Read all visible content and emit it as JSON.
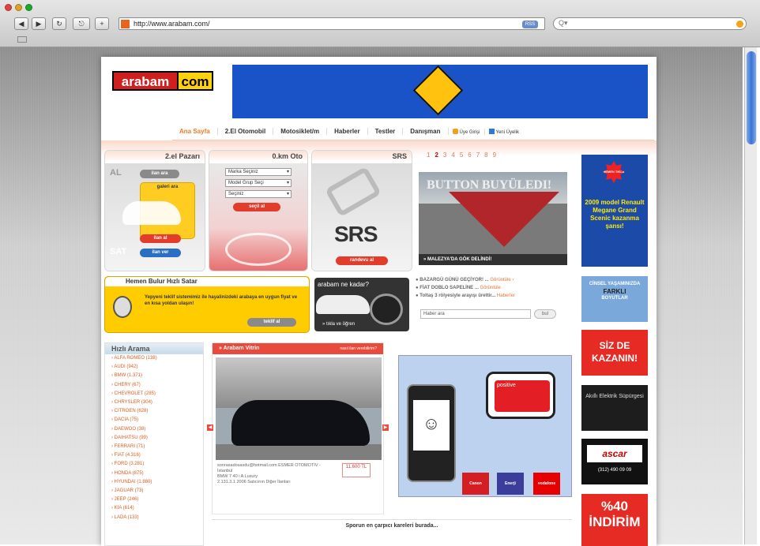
{
  "browser": {
    "url": "http://www.arabam.com/",
    "rss_label": "RSS",
    "search_placeholder": "Q▾"
  },
  "site": {
    "logo_part1": "arabam",
    "logo_part2": "com"
  },
  "nav": {
    "items": [
      "Ana Sayfa",
      "2.El Otomobil",
      "Motosiklet/m",
      "Haberler",
      "Testler",
      "Danışman"
    ],
    "login": "Üye Girişi",
    "register": "Yeni Üyelik"
  },
  "panels": {
    "ikinciel": {
      "title": "2.el Pazarı",
      "al": "AL",
      "sat": "SAT",
      "ilan_ara": "ilan ara",
      "galeri_ara": "galeri ara",
      "ilan_ver": "ilan ver",
      "ilan_al": "ilan al"
    },
    "sifir": {
      "title": "0.km Oto",
      "marka": "Marka Seçiniz",
      "model": "Model Grup Seçi",
      "secim": "Seçiniz",
      "button": "seçil al"
    },
    "srs": {
      "title": "SRS",
      "logo": "SRS",
      "button": "randevu al"
    }
  },
  "slider": {
    "pages": [
      "1",
      "2",
      "3",
      "4",
      "5",
      "6",
      "7",
      "8",
      "9"
    ],
    "current": "2",
    "title": "BUTTON BUYÜLEDI!",
    "caption": "» MALEZYA'DA GÖK DELİNDİ!"
  },
  "hemen": {
    "title": "Hemen Bulur Hızlı Satar",
    "text": "Yepyeni teklif sistemimiz ile hayalinizdeki arabaya en uygun fiyat ve en kısa yoldan ulaşın!",
    "button": "teklif al"
  },
  "arabam_ne_kadar": {
    "title": "arabam ne kadar?",
    "footer": "» tıkla ve öğren"
  },
  "news": {
    "items": [
      "BAZARGÜ GÜNÜ GEÇİYOR! ...",
      "FİAT DOBLO SAPELİNE ...",
      "Toltaş 3 rölyesiyle arayışı ürettir..."
    ],
    "links": [
      "Görüntüle ›",
      "Görüntüle",
      "Haberler"
    ],
    "search_placeholder": "Haber ara",
    "search_button": "bul"
  },
  "hizli": {
    "title": "Hızlı Arama",
    "brands": [
      "› ALFA ROMEO (138)",
      "› AUDI (942)",
      "› BMW (1.371)",
      "› CHERY (67)",
      "› CHEVROLET (285)",
      "› CHRYSLER (304)",
      "› CITROEN (628)",
      "› DACIA (75)",
      "› DAEWOO (38)",
      "› DAIHATSU (99)",
      "› FERRARI (71)",
      "› FIAT (4.316)",
      "› FORD (3.281)",
      "› HONDA (875)",
      "› HYUNDAI (1.880)",
      "› JAGUAR (73)",
      "› JEEP (246)",
      "› KIA (614)",
      "› LADA (133)"
    ]
  },
  "vitrin": {
    "title": "» Arabam Vitrin",
    "more": "nasıl ilan verebilirim?",
    "seller": "sonrasadosasdu@hotmail.com ESMER OTOMOTİV - İstanbul",
    "model": "BMW 7 40 i A Luxury",
    "info": "2.131.3.1 2006  Satıcının Diğer İlanları",
    "price": "11.600 TL"
  },
  "phone_ad": {
    "brand": "positive",
    "logos": [
      "Canon",
      "Enerji",
      "vodafone"
    ]
  },
  "side_ads": {
    "ad1_star": "HEMEN TIKLA",
    "ad1_text": "2009 model Renault Megane Grand Scenic kazanma şansı!",
    "ad2_line1": "CİNSEL YAŞAMINIZDA",
    "ad2_line2": "FARKLI",
    "ad2_line3": "BOYUTLAR",
    "ad3": "SİZ DE KAZANIN!",
    "ad4": "Akıllı Elektrik Süpürgesi",
    "ad5_logo": "ascar",
    "ad5_phone": "(312) 490 09 09",
    "ad6": "%40 İNDİRİM"
  },
  "sport": "Sporun en çarpıcı kareleri burada..."
}
